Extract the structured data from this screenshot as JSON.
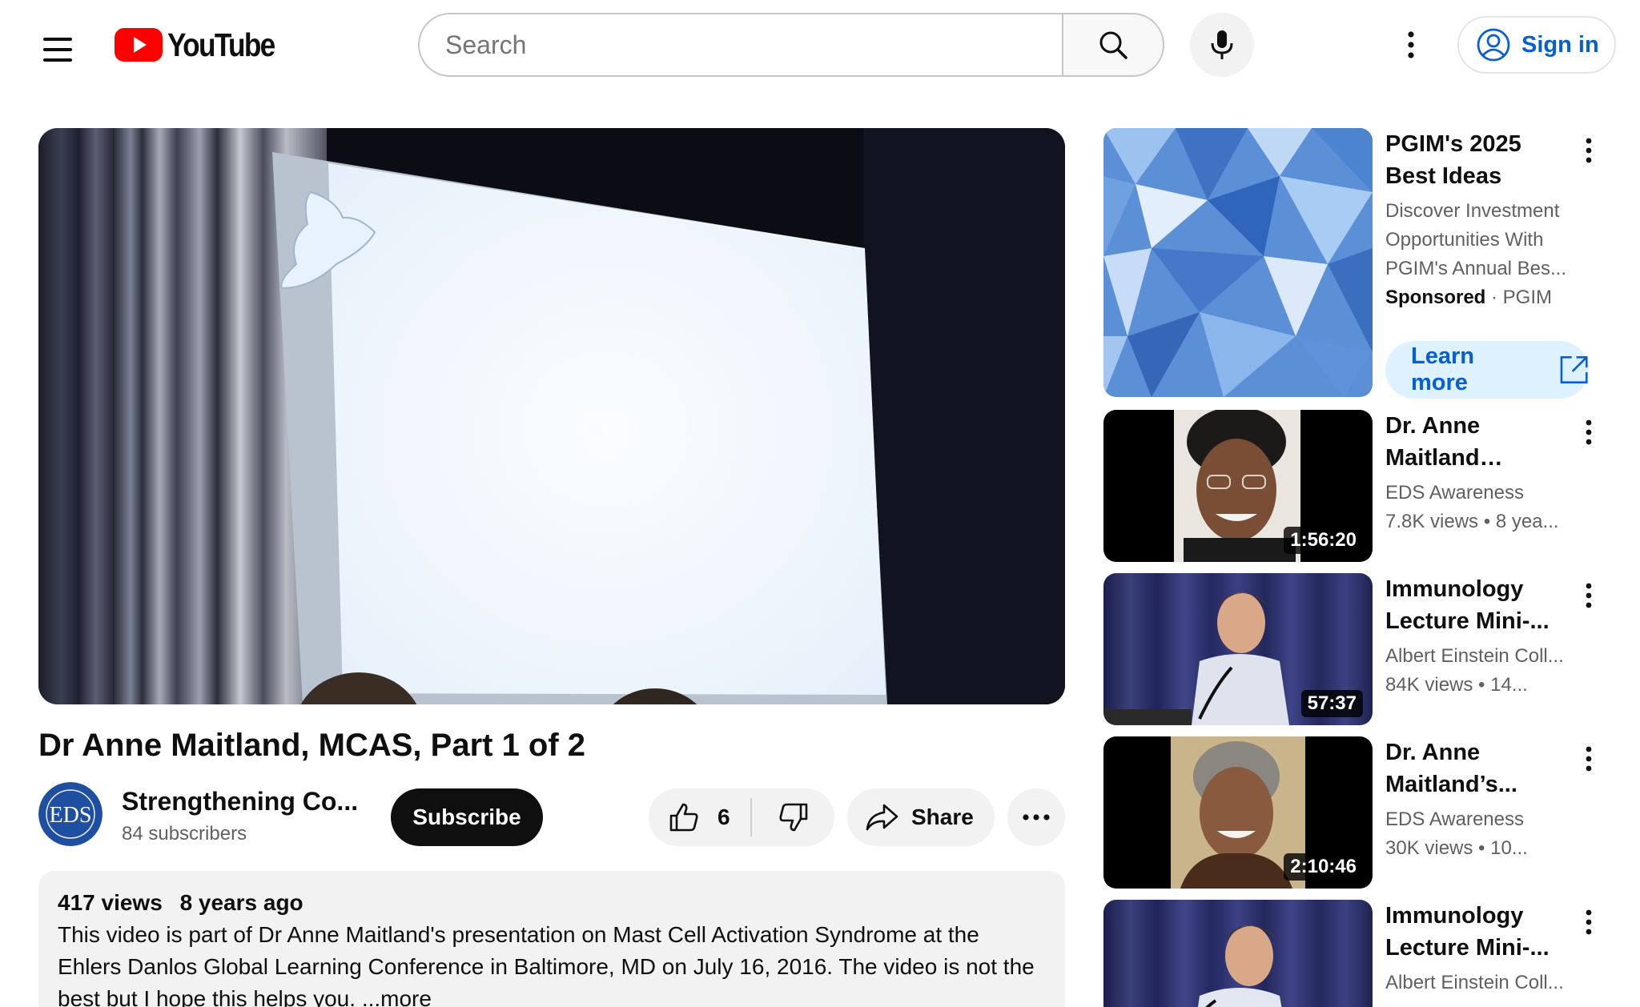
{
  "masthead": {
    "logo_text": "YouTube",
    "search_placeholder": "Search",
    "sign_in_label": "Sign in"
  },
  "video": {
    "title": "Dr Anne Maitland, MCAS, Part 1 of 2",
    "channel_name": "Strengthening Co...",
    "channel_avatar_text": "EDS",
    "subscribers": "84 subscribers",
    "subscribe_label": "Subscribe",
    "like_count": "6",
    "share_label": "Share"
  },
  "description": {
    "views": "417 views",
    "age": "8 years ago",
    "text": "This video is part of Dr Anne Maitland's presentation on Mast Cell Activation Syndrome at the Ehlers Danlos Global Learning Conference in Baltimore, MD on July 16, 2016.  The video is not the best but I hope this helps you.",
    "more_label": "...more"
  },
  "sidebar": {
    "ad": {
      "title": "PGIM's 2025 Best Ideas",
      "description": "Discover Investment Opportunities With PGIM's Annual Bes...",
      "sponsored_label": "Sponsored",
      "advertiser": "PGIM",
      "cta_label": "Learn more"
    },
    "items": [
      {
        "title": "Dr. Anne Maitland presents “Mast...",
        "channel": "EDS Awareness",
        "views": "7.8K views",
        "age": "8 yea...",
        "duration": "1:56:20"
      },
      {
        "title": "Immunology Lecture Mini-...",
        "channel": "Albert Einstein Coll...",
        "views": "84K views",
        "age": "14...",
        "duration": "57:37"
      },
      {
        "title": "Dr. Anne Maitland’s...",
        "channel": "EDS Awareness",
        "views": "30K views",
        "age": "10...",
        "duration": "2:10:46"
      },
      {
        "title": "Immunology Lecture Mini-...",
        "channel": "Albert Einstein Coll...",
        "views": "",
        "age": "",
        "duration": ""
      }
    ]
  },
  "colors": {
    "brand_red": "#ff0000",
    "link_blue": "#065fd4",
    "subscribe_bg": "#0f0f0f",
    "chip_bg": "#f2f2f2"
  }
}
